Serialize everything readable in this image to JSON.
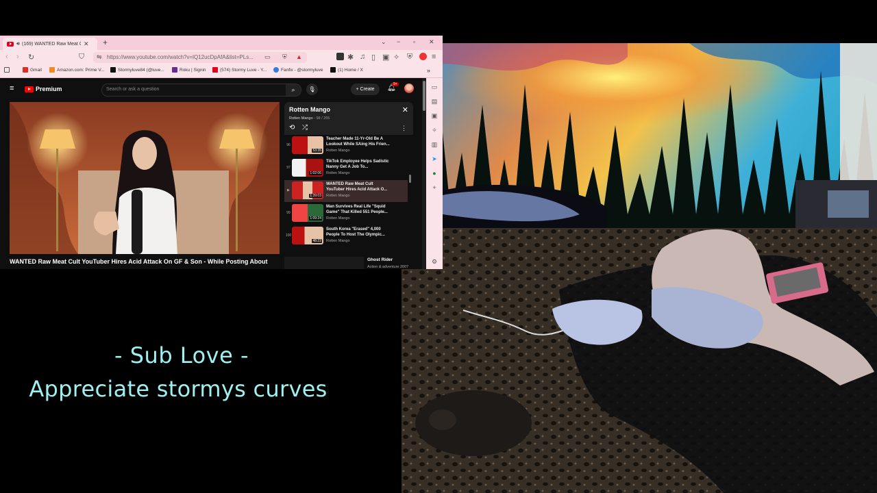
{
  "browser": {
    "tab": {
      "title": "(169) WANTED Raw Meat Cult Y",
      "close": "✕"
    },
    "window_controls": {
      "minimize": "−",
      "maximize": "▫",
      "close": "✕"
    },
    "url": "https://www.youtube.com/watch?v=lQ12ucDpAfA&list=PLs...",
    "bookmarks": [
      {
        "label": "",
        "icon_name": "apps-grid-icon",
        "color": "#555555"
      },
      {
        "label": "Gmail",
        "icon_name": "gmail-icon",
        "color": "#d93025"
      },
      {
        "label": "Amazon.com: Prime V...",
        "icon_name": "amazon-icon",
        "color": "#f08a24"
      },
      {
        "label": "Stormyluve84 (@luve...",
        "icon_name": "x-icon",
        "color": "#111111"
      },
      {
        "label": "Roku | Signin",
        "icon_name": "roku-icon",
        "color": "#662d91"
      },
      {
        "label": "(574) Stormy Luve - Y...",
        "icon_name": "youtube-icon",
        "color": "#e0001a"
      },
      {
        "label": "Fanfix - @stormyluve",
        "icon_name": "fanfix-icon",
        "color": "#3a7bd5"
      },
      {
        "label": "(1) Home / X",
        "icon_name": "x-icon",
        "color": "#111111"
      }
    ]
  },
  "youtube": {
    "brand": "Premium",
    "search_placeholder": "Search or ask a question",
    "create_label": "Create",
    "notification_count": "9+",
    "video_title": "WANTED Raw Meat Cult YouTuber Hires Acid Attack On GF & Son - While Posting About",
    "playlist": {
      "title": "Rotten Mango",
      "channel": "Rotten Mango",
      "position": "98 / 265",
      "items": [
        {
          "index": "96",
          "title": "Teacher Made 11-Yr-Old Be A Lookout While SAing His Frien...",
          "channel": "Rotten Mango",
          "duration": "53:35",
          "active": false
        },
        {
          "index": "97",
          "title": "TikTok Employee Helps Sadistic Nanny Get A Job To...",
          "channel": "Rotten Mango",
          "duration": "1:02:06",
          "active": false
        },
        {
          "index": "▶",
          "title": "WANTED Raw Meat Cult YouTuber Hires Acid Attack O...",
          "channel": "Rotten Mango",
          "duration": "1:39:03",
          "active": true
        },
        {
          "index": "99",
          "title": "Man Survives Real Life \"Squid Game\" That Killed 551 People...",
          "channel": "Rotten Mango",
          "duration": "1:09:24",
          "active": false
        },
        {
          "index": "100",
          "title": "South Korea \"Erased\" 4,000 People To Host The Olympic...",
          "channel": "Rotten Mango",
          "duration": "48:22",
          "active": false
        }
      ]
    },
    "recommendation": {
      "title": "Ghost Rider",
      "subtitle": "Action & adventure 2007"
    }
  },
  "overlay": {
    "line1": "- Sub Love -",
    "line2": "Appreciate stormys curves"
  },
  "colors": {
    "browser_chrome": "#fbe3ea",
    "overlay_text": "#9ff0f0",
    "youtube_red": "#ff0000"
  }
}
